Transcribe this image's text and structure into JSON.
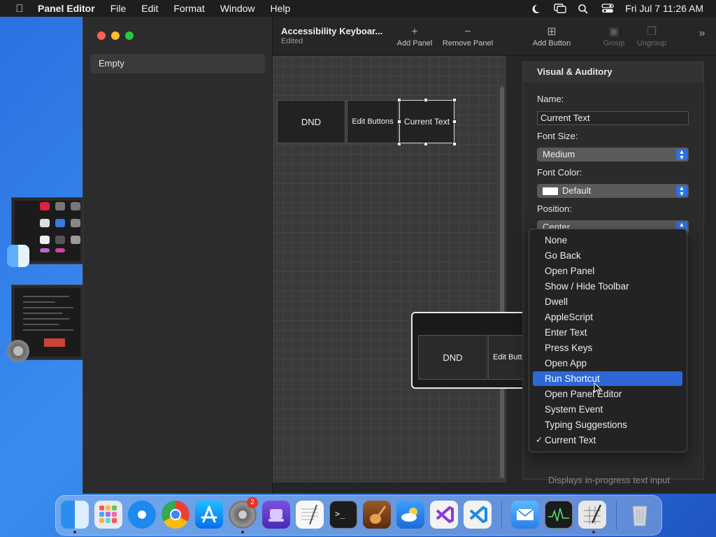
{
  "menubar": {
    "app_name": "Panel Editor",
    "items": [
      "File",
      "Edit",
      "Format",
      "Window",
      "Help"
    ],
    "clock": "Fri Jul 7  11:26 AM"
  },
  "sidebar": {
    "items": [
      {
        "label": "Empty"
      }
    ]
  },
  "toolbar": {
    "document_title": "Accessibility Keyboar...",
    "document_status": "Edited",
    "add_panel": "Add Panel",
    "remove_panel": "Remove Panel",
    "add_button": "Add Button",
    "group": "Group",
    "ungroup": "Ungroup"
  },
  "canvas": {
    "buttons": [
      "DND",
      "Edit Buttons",
      "Current Text"
    ],
    "preview_buttons": [
      "DND",
      "Edit Butto"
    ]
  },
  "inspector": {
    "header": "Visual & Auditory",
    "name_label": "Name:",
    "name_value": "Current Text",
    "font_size_label": "Font Size:",
    "font_size_value": "Medium",
    "font_color_label": "Font Color:",
    "font_color_value": "Default",
    "position_label": "Position:",
    "position_value": "Center",
    "hint": "Displays in-progress text input"
  },
  "action_menu": {
    "items": [
      "None",
      "Go Back",
      "Open Panel",
      "Show / Hide Toolbar",
      "Dwell",
      "AppleScript",
      "Enter Text",
      "Press Keys",
      "Open App",
      "Run Shortcut",
      "Open Panel Editor",
      "System Event",
      "Typing Suggestions",
      "Current Text"
    ],
    "highlighted": "Run Shortcut",
    "checked": "Current Text"
  },
  "dock": {
    "system_settings_badge": "2"
  },
  "colors": {
    "accent": "#2d67d8",
    "window_bg": "#262626",
    "menu_bg": "#232323"
  }
}
